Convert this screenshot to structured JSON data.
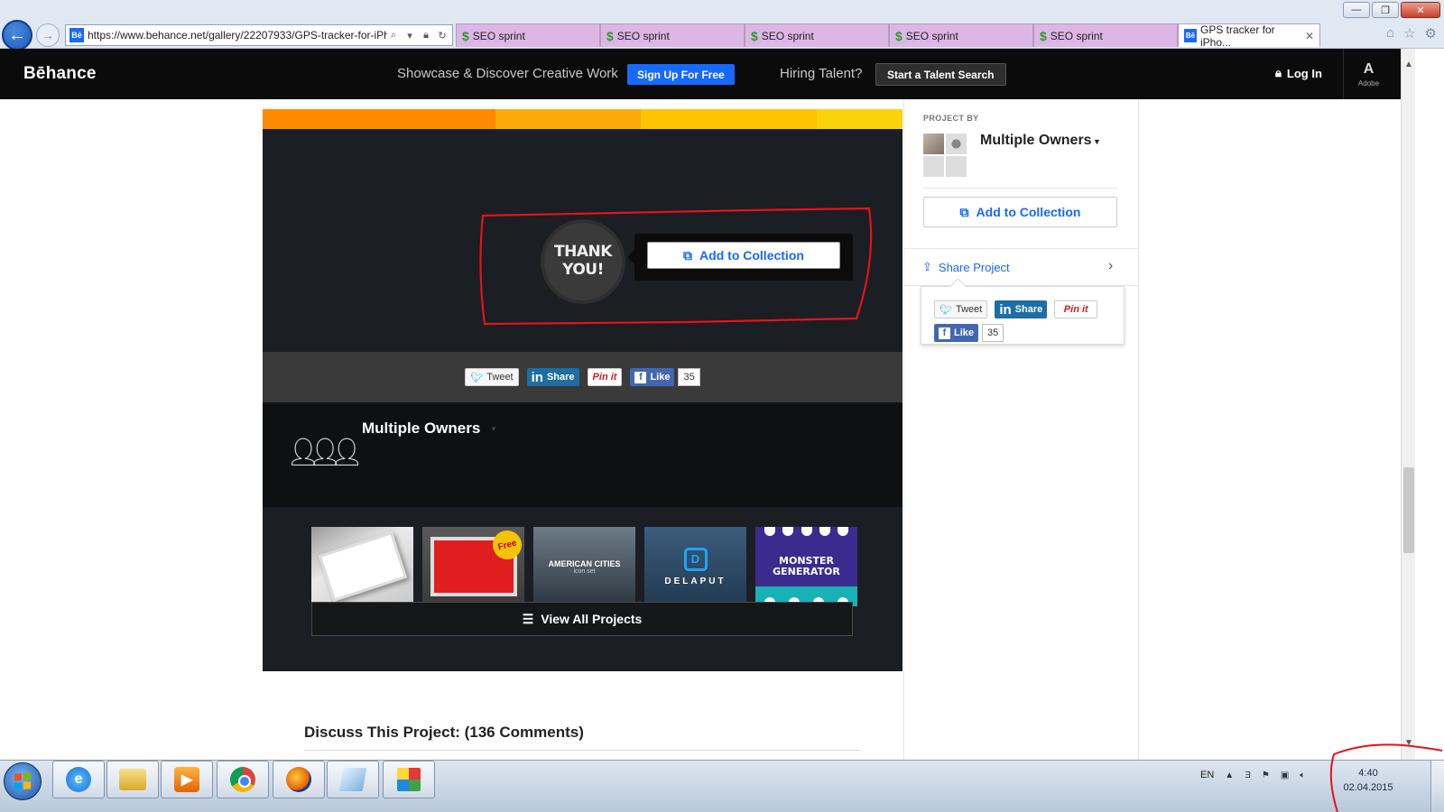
{
  "browser": {
    "address_url": "https://www.behance.net/gallery/22207933/GPS-tracker-for-iPho",
    "tabs": [
      {
        "label": "SEO sprint"
      },
      {
        "label": "SEO sprint"
      },
      {
        "label": "SEO sprint"
      },
      {
        "label": "SEO sprint"
      },
      {
        "label": "SEO sprint"
      },
      {
        "label": "GPS tracker for iPho..."
      }
    ]
  },
  "header": {
    "logo": "Bēhance",
    "tagline": "Showcase & Discover Creative Work",
    "signup_label": "Sign Up For Free",
    "hiring_text": "Hiring Talent?",
    "talent_search_label": "Start a Talent Search",
    "login_label": "Log In",
    "adobe_label": "Adobe"
  },
  "project": {
    "stripe_colors": [
      "#ff8a00",
      "#fbaa0a",
      "#ffc400",
      "#fbd30b"
    ],
    "thank_you": [
      "THANK",
      "YOU!"
    ],
    "add_collection_label": "Add to Collection",
    "share": {
      "tweet": "Tweet",
      "linkedin": "Share",
      "pinit": "Pin it",
      "like": "Like",
      "like_count": "35"
    },
    "owners_name": "Multiple Owners",
    "more_projects": [
      {
        "label": ""
      },
      {
        "label": "Free"
      },
      {
        "label": "AMERICAN CITIES",
        "sub": "icon set"
      },
      {
        "label": "DELAPUT"
      },
      {
        "label": "MONSTER GENERATOR"
      }
    ],
    "view_all_label": "View All Projects",
    "discuss_label": "Discuss This Project: (136 Comments)"
  },
  "sidebar": {
    "project_by_label": "PROJECT BY",
    "owner_name": "Multiple Owners",
    "add_collection_label": "Add to Collection",
    "share_project_label": "Share Project",
    "share": {
      "tweet": "Tweet",
      "linkedin": "Share",
      "pinit": "Pin it",
      "like": "Like",
      "like_count": "35"
    }
  },
  "taskbar": {
    "language": "EN",
    "time": "4:40",
    "date": "02.04.2015"
  },
  "colors": {
    "behance_blue": "#1769ff",
    "header_bg": "#0b0b0b",
    "annotation_red": "#e3141b"
  }
}
